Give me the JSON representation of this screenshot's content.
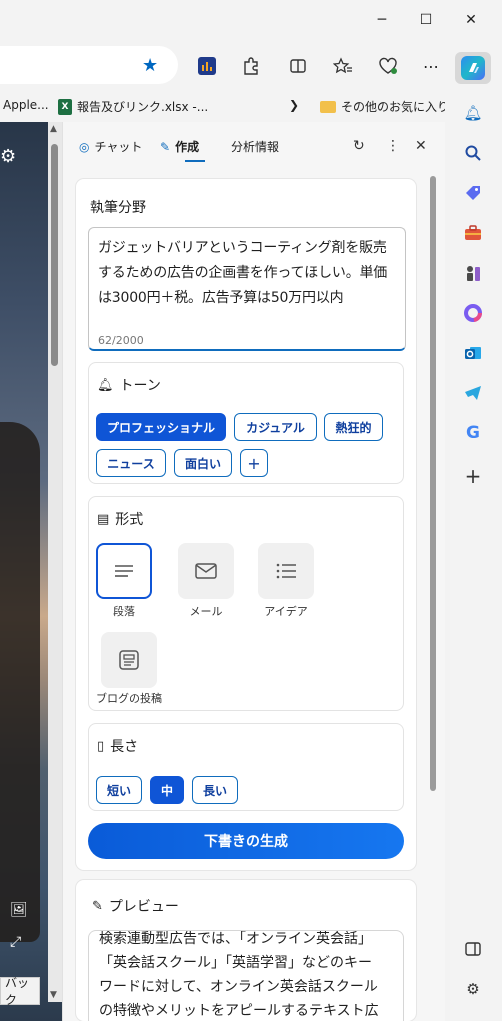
{
  "window": {
    "minimize": "─",
    "maximize": "☐",
    "close": "✕"
  },
  "toolbar": {
    "more": "⋯"
  },
  "favorites": {
    "item1": "Apple...",
    "item2": "報告及びリンク.xlsx -...",
    "item2_badge": "X",
    "more_chevron": "❯",
    "other": "その他のお気に入り"
  },
  "page": {
    "back_button": "バック"
  },
  "sidebar": {
    "tabs": {
      "chat": "チャット",
      "compose": "作成",
      "insights": "分析情報"
    },
    "topic_label": "執筆分野",
    "prompt_text": "ガジェットバリアというコーティング剤を販売するための広告の企画書を作ってほしい。単価は3000円＋税。広告予算は50万円以内",
    "char_count": "62/2000",
    "tone": {
      "label": "トーン",
      "options": [
        "プロフェッショナル",
        "カジュアル",
        "熱狂的",
        "ニュース",
        "面白い"
      ],
      "selected": "プロフェッショナル",
      "add": "+"
    },
    "format": {
      "label": "形式",
      "options": [
        "段落",
        "メール",
        "アイデア",
        "ブログの投稿"
      ],
      "selected": "段落"
    },
    "length": {
      "label": "長さ",
      "options": [
        "短い",
        "中",
        "長い"
      ],
      "selected": "中"
    },
    "generate_button": "下書きの生成",
    "preview": {
      "label": "プレビュー",
      "lines": [
        "検索連動型広告では、「オンライン英会話」",
        "「英会話スクール」「英語学習」などのキー",
        "ワードに対して、オンライン英会話スクール",
        "の特徴やメリットをアピールするテキスト広"
      ]
    }
  },
  "colors": {
    "accent": "#0f55d6",
    "link": "#0f6cbd"
  }
}
